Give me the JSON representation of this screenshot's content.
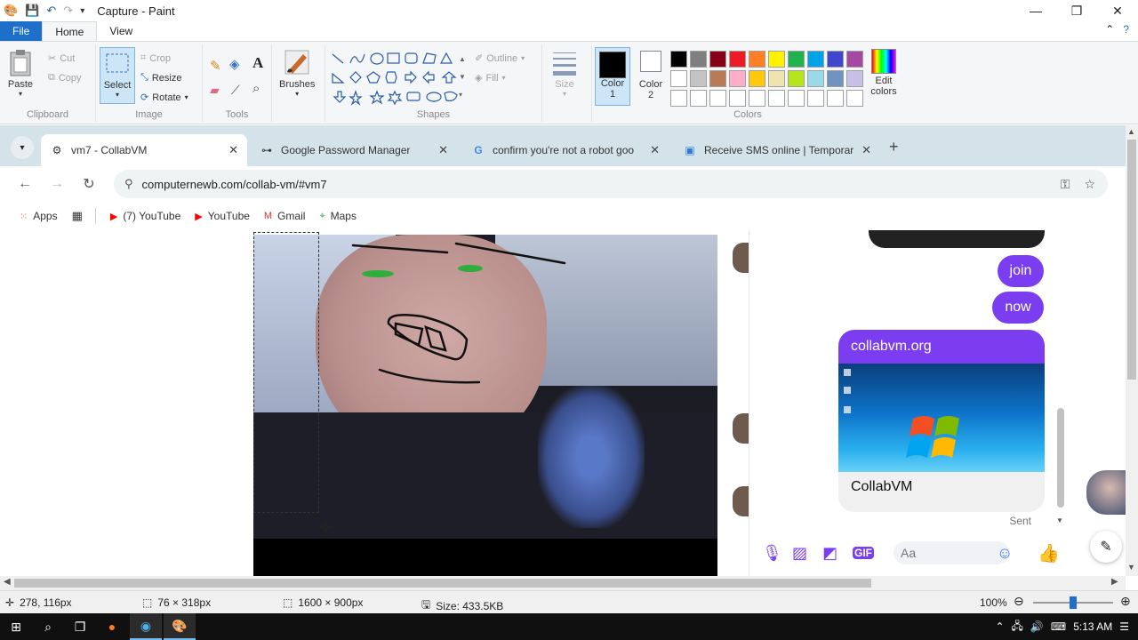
{
  "window": {
    "title": "Capture - Paint",
    "minimize": "—",
    "maximize": "❐",
    "close": "✕"
  },
  "ribbon_tabs": {
    "file": "File",
    "home": "Home",
    "view": "View"
  },
  "ribbon": {
    "clipboard": {
      "paste": "Paste",
      "cut": "Cut",
      "copy": "Copy",
      "label": "Clipboard"
    },
    "image": {
      "select": "Select",
      "crop": "Crop",
      "resize": "Resize",
      "rotate": "Rotate",
      "label": "Image"
    },
    "tools": {
      "label": "Tools"
    },
    "brushes": {
      "label": "Brushes"
    },
    "shapes": {
      "outline": "Outline",
      "fill": "Fill",
      "label": "Shapes"
    },
    "size": {
      "label": "Size"
    },
    "color1": {
      "line1": "Color",
      "line2": "1",
      "value": "#000000"
    },
    "color2": {
      "line1": "Color",
      "line2": "2",
      "value": "#ffffff"
    },
    "colors": {
      "label": "Colors"
    },
    "edit_colors": {
      "line1": "Edit",
      "line2": "colors"
    },
    "palette_row1": [
      "#000000",
      "#7f7f7f",
      "#880015",
      "#ed1c24",
      "#ff7f27",
      "#fff200",
      "#22b14c",
      "#00a2e8",
      "#3f48cc",
      "#a349a4"
    ],
    "palette_row2": [
      "#ffffff",
      "#c3c3c3",
      "#b97a57",
      "#ffaec9",
      "#ffc90e",
      "#efe4b0",
      "#b5e61d",
      "#99d9ea",
      "#7092be",
      "#c8bfe7"
    ],
    "palette_row3": [
      "#ffffff",
      "#ffffff",
      "#ffffff",
      "#ffffff",
      "#ffffff",
      "#ffffff",
      "#ffffff",
      "#ffffff",
      "#ffffff",
      "#ffffff"
    ]
  },
  "browser": {
    "tabs": [
      {
        "label": "vm7 - CollabVM",
        "icon": "collabvm-icon",
        "close": "✕"
      },
      {
        "label": "Google Password Manager",
        "icon": "key-icon",
        "close": "✕"
      },
      {
        "label": "confirm you're not a robot goo",
        "icon": "google-icon",
        "close": "✕"
      },
      {
        "label": "Receive SMS online | Temporar",
        "icon": "sms-site-icon",
        "close": "✕"
      }
    ],
    "new_tab": "+",
    "url": "computernewb.com/collab-vm/#vm7",
    "bookmarks": [
      {
        "label": "Apps"
      },
      {
        "label": "(7) YouTube"
      },
      {
        "label": "YouTube"
      },
      {
        "label": "Gmail"
      },
      {
        "label": "Maps"
      }
    ]
  },
  "chat": {
    "messages": [
      "join",
      "now"
    ],
    "link_site": "collabvm.org",
    "link_title": "CollabVM",
    "status": "Sent",
    "composer_placeholder": "Aa"
  },
  "statusbar": {
    "cursor_pos": "278, 116px",
    "selection_size": "76 × 318px",
    "image_size": "1600 × 900px",
    "file_size": "Size: 433.5KB",
    "zoom": "100%",
    "zoom_fraction": 0.5
  },
  "taskbar": {
    "time": "5:13 AM"
  }
}
